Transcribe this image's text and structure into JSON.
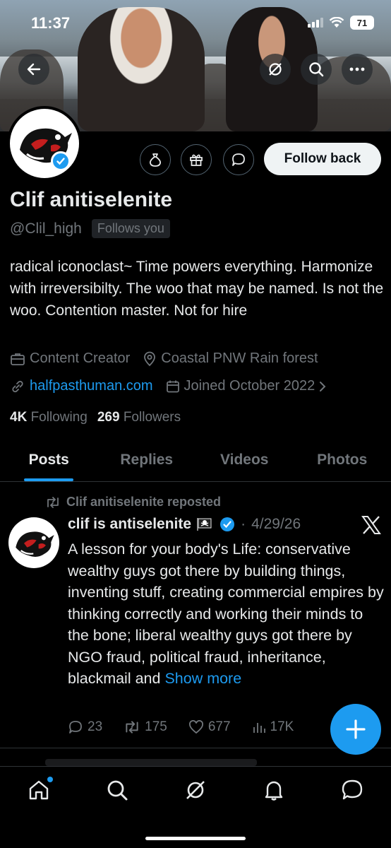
{
  "status_bar": {
    "time": "11:37",
    "battery": "71"
  },
  "banner": {
    "icons": [
      "back-arrow-icon",
      "grok-icon",
      "search-icon",
      "more-icon"
    ]
  },
  "profile": {
    "follow_button": "Follow back",
    "name": "Clif anitiselenite",
    "handle": "@Clil_high",
    "follows_you": "Follows you",
    "bio": "radical iconoclast~ Time powers everything. Harmonize with irreversibilty. The woo that may be named. Is not the woo. Contention master. Not for hire",
    "category": "Content Creator",
    "location": "Coastal PNW Rain forest",
    "website": "halfpasthuman.com",
    "joined": "Joined October 2022",
    "following_count": "4K",
    "following_label": "Following",
    "followers_count": "269",
    "followers_label": "Followers"
  },
  "tabs": [
    {
      "label": "Posts"
    },
    {
      "label": "Replies"
    },
    {
      "label": "Videos"
    },
    {
      "label": "Photos"
    }
  ],
  "post": {
    "repost_text": "Clif anitiselenite reposted",
    "author": "clif is antiselenite",
    "date": "4/29/26",
    "body": "A lesson for your body's Life: conservative wealthy guys got there by building things, inventing stuff, creating commercial empires by thinking correctly and working their minds to the bone; liberal wealthy guys got there by NGO fraud, political fraud, inheritance, blackmail and ",
    "show_more": "Show more",
    "replies": "23",
    "reposts": "175",
    "likes": "677",
    "views": "17K"
  },
  "colors": {
    "accent": "#1d9bf0",
    "background": "#000000",
    "muted": "#71767b"
  }
}
